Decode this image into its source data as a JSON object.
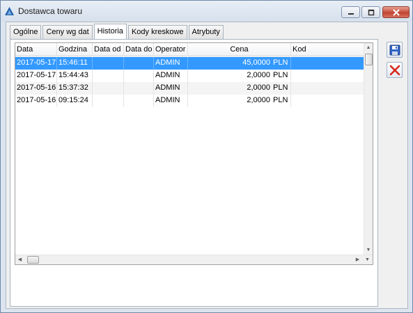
{
  "window": {
    "title": "Dostawca towaru",
    "minimize_glyph": "–",
    "maximize_glyph": "□",
    "close_glyph": "✕"
  },
  "tabs": [
    {
      "label": "Ogólne",
      "active": false
    },
    {
      "label": "Ceny wg dat",
      "active": false
    },
    {
      "label": "Historia",
      "active": true
    },
    {
      "label": "Kody kreskowe",
      "active": false
    },
    {
      "label": "Atrybuty",
      "active": false
    }
  ],
  "grid": {
    "columns": [
      "Data",
      "Godzina",
      "Data od",
      "Data do",
      "Operator",
      "Cena",
      "",
      "Kod"
    ],
    "rows": [
      {
        "data": "2017-05-17",
        "godzina": "15:46:11",
        "data_od": "",
        "data_do": "",
        "operator": "ADMIN",
        "cena": "45,0000",
        "waluta": "PLN",
        "kod": ""
      },
      {
        "data": "2017-05-17",
        "godzina": "15:44:43",
        "data_od": "",
        "data_do": "",
        "operator": "ADMIN",
        "cena": "2,0000",
        "waluta": "PLN",
        "kod": ""
      },
      {
        "data": "2017-05-16",
        "godzina": "15:37:32",
        "data_od": "",
        "data_do": "",
        "operator": "ADMIN",
        "cena": "2,0000",
        "waluta": "PLN",
        "kod": ""
      },
      {
        "data": "2017-05-16",
        "godzina": "09:15:24",
        "data_od": "",
        "data_do": "",
        "operator": "ADMIN",
        "cena": "2,0000",
        "waluta": "PLN",
        "kod": ""
      }
    ],
    "selected_row": 0
  },
  "scroll": {
    "up": "▲",
    "down": "▼",
    "left": "◀",
    "right": "▶"
  },
  "side_buttons": [
    {
      "name": "save-icon"
    },
    {
      "name": "delete-icon"
    }
  ],
  "colors": {
    "selection": "#3399ff",
    "delete_red": "#d9261c",
    "save_blue": "#2f66c7"
  }
}
